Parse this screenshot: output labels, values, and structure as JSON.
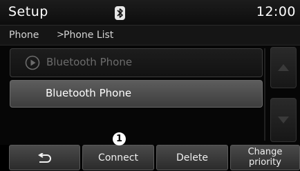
{
  "header": {
    "title": "Setup",
    "status_icon": "bluetooth-icon",
    "clock": "12:00"
  },
  "breadcrumb": {
    "parent": "Phone",
    "separator": ">",
    "current": "Phone List"
  },
  "phone_list": {
    "items": [
      {
        "label": "Bluetooth Phone",
        "icon": "play-icon",
        "state": "dimmed"
      },
      {
        "label": "Bluetooth Phone",
        "state": "selected"
      }
    ]
  },
  "scroll": {
    "up_icon": "scroll-up-arrow-icon",
    "down_icon": "scroll-down-arrow-icon"
  },
  "bottom_bar": {
    "back_icon": "back-arrow-icon",
    "connect_label": "Connect",
    "delete_label": "Delete",
    "priority_line1": "Change",
    "priority_line2": "priority"
  },
  "callout": {
    "number": "1"
  },
  "colors": {
    "background": "#060606",
    "selected_item": "#4d4d4d",
    "dimmed_text": "#6c6c6c",
    "text": "#ffffff"
  }
}
